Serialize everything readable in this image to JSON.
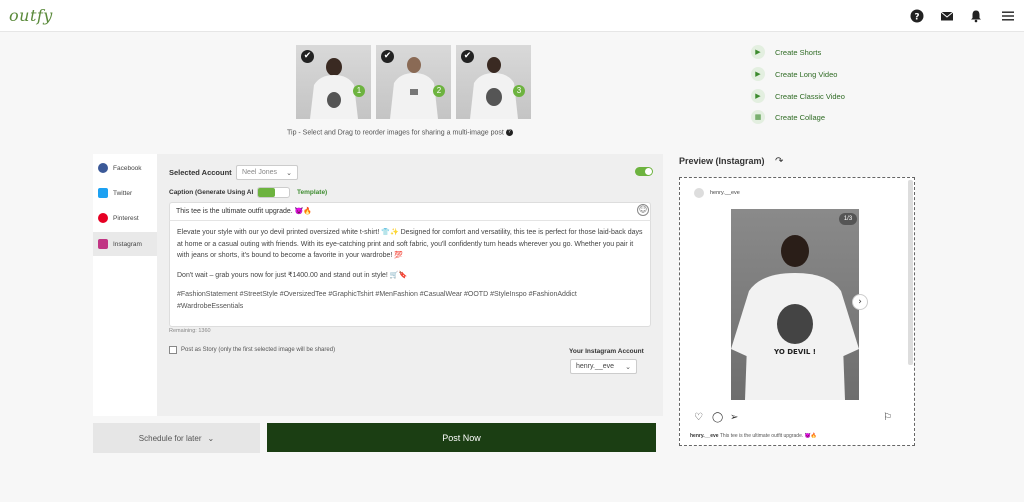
{
  "header": {
    "logo": "outfy",
    "icons": [
      "help-icon",
      "mail-icon",
      "bell-icon",
      "menu-icon"
    ]
  },
  "thumbnails": [
    {
      "check": "✔",
      "number": "1"
    },
    {
      "check": "✔",
      "number": "2"
    },
    {
      "check": "✔",
      "number": "3"
    }
  ],
  "tip": "Tip - Select and Drag to reorder images for sharing a multi-image post",
  "actions": [
    {
      "label": "Create Shorts",
      "icon": "play-icon"
    },
    {
      "label": "Create Long Video",
      "icon": "play-icon"
    },
    {
      "label": "Create Classic Video",
      "icon": "play-icon"
    },
    {
      "label": "Create Collage",
      "icon": "collage-icon"
    }
  ],
  "sidebar": {
    "items": [
      {
        "label": "Facebook",
        "color": "#3b5998"
      },
      {
        "label": "Twitter",
        "color": "#1da1f2"
      },
      {
        "label": "Pinterest",
        "color": "#e60023"
      },
      {
        "label": "Instagram",
        "color": "#c13584"
      }
    ]
  },
  "editor": {
    "account_label": "Selected Account",
    "account_value": "Neel Jones",
    "caption_label": "Caption (Generate Using AI",
    "template_label": "Template)",
    "caption_first": "This tee is the ultimate outfit upgrade. 😈🔥",
    "caption_p1": "Elevate your style with our yo devil printed oversized white t-shirt! 👕✨ Designed for comfort and versatility, this tee is perfect for those laid-back days at home or a casual outing with friends. With its eye-catching print and soft fabric, you'll confidently turn heads wherever you go. Whether you pair it with jeans or shorts, it's bound to become a favorite in your wardrobe! 💯",
    "caption_p2": "Don't wait – grab yours now for just ₹1400.00 and stand out in style! 🛒🔖",
    "caption_tags": "#FashionStatement #StreetStyle #OversizedTee #GraphicTshirt #MenFashion #CasualWear #OOTD #StyleInspo #FashionAddict #WardrobeEssentials",
    "remaining": "Remaining: 1360",
    "story_label": "Post as Story (only the first selected image will be shared)",
    "ig_account_label": "Your Instagram Account",
    "ig_account_value": "henry.__eve"
  },
  "buttons": {
    "schedule": "Schedule for later",
    "post": "Post Now"
  },
  "preview": {
    "title": "Preview (Instagram)",
    "username": "henry.__eve",
    "counter": "1/3",
    "caption_user": "henry.__eve",
    "caption_text": "This tee is the ultimate outfit upgrade. 😈🔥"
  },
  "colors": {
    "brand_green": "#6db33f",
    "post_button": "#1b3e13"
  }
}
